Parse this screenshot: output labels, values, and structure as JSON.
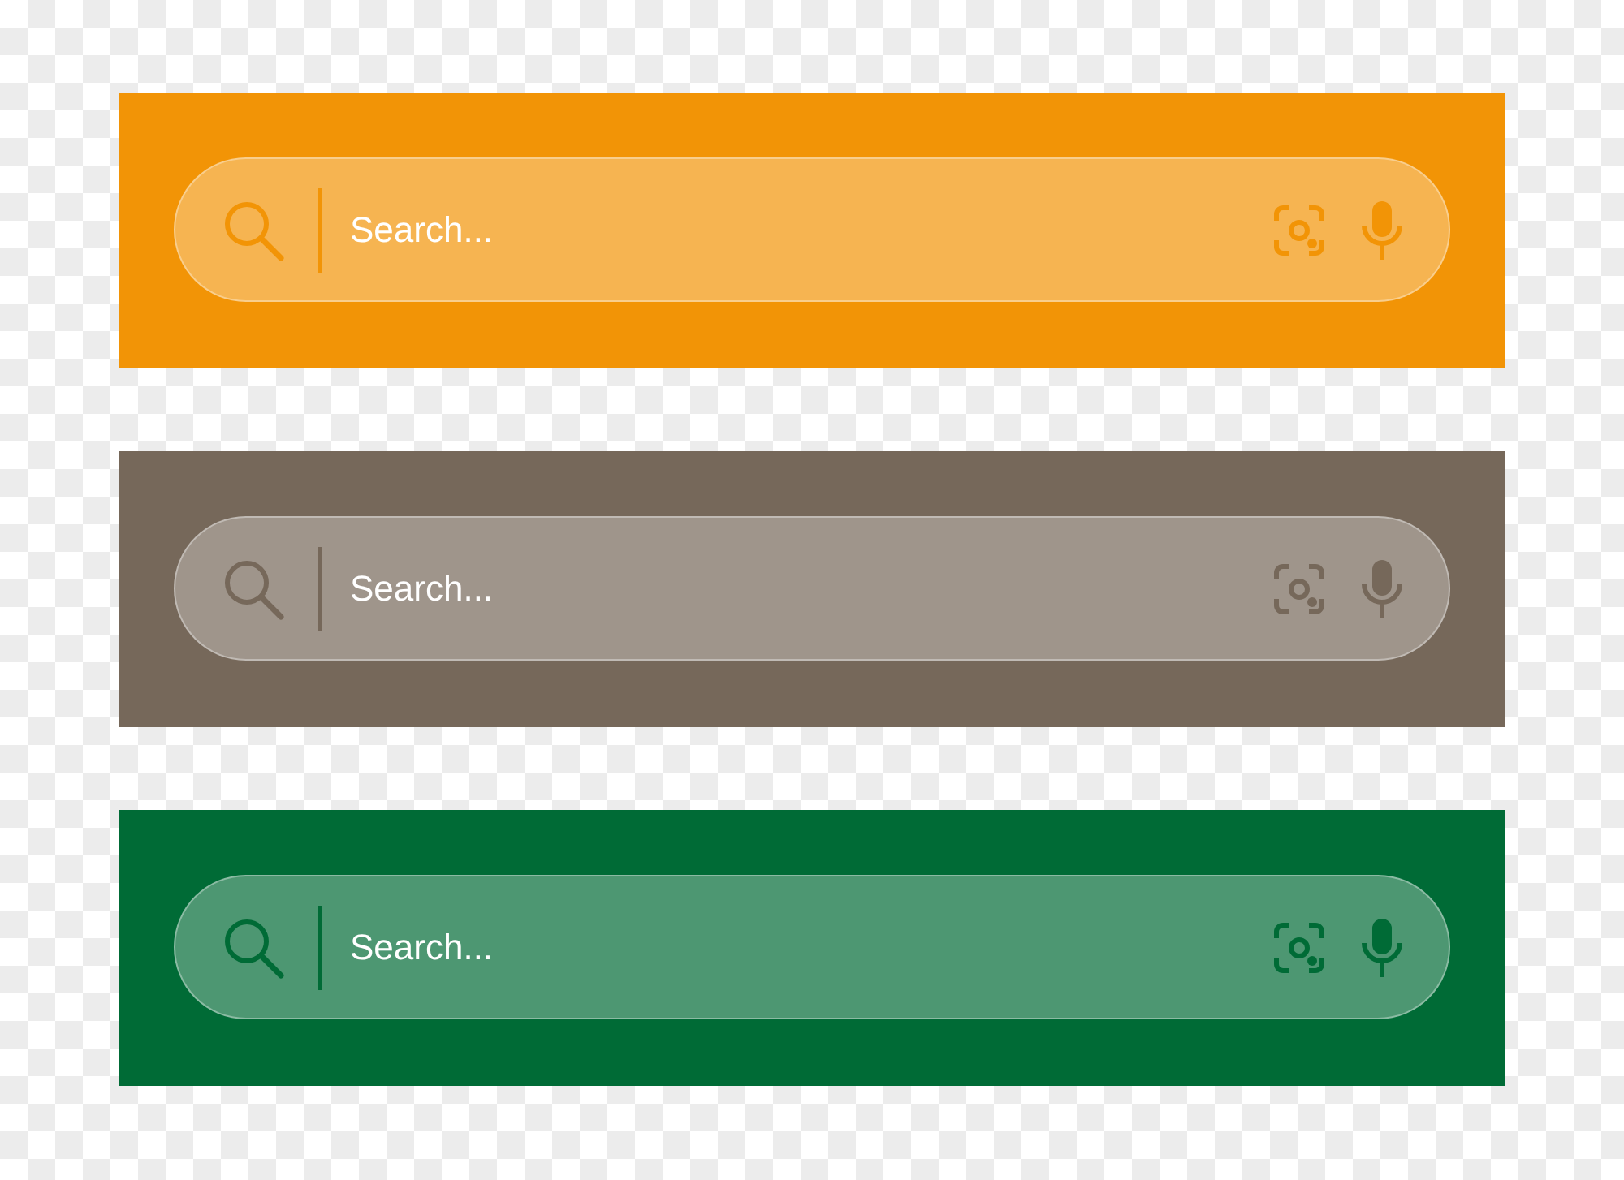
{
  "search_bars": [
    {
      "color": "#f29406",
      "placeholder": "Search..."
    },
    {
      "color": "#76685a",
      "placeholder": "Search..."
    },
    {
      "color": "#006b36",
      "placeholder": "Search..."
    }
  ]
}
